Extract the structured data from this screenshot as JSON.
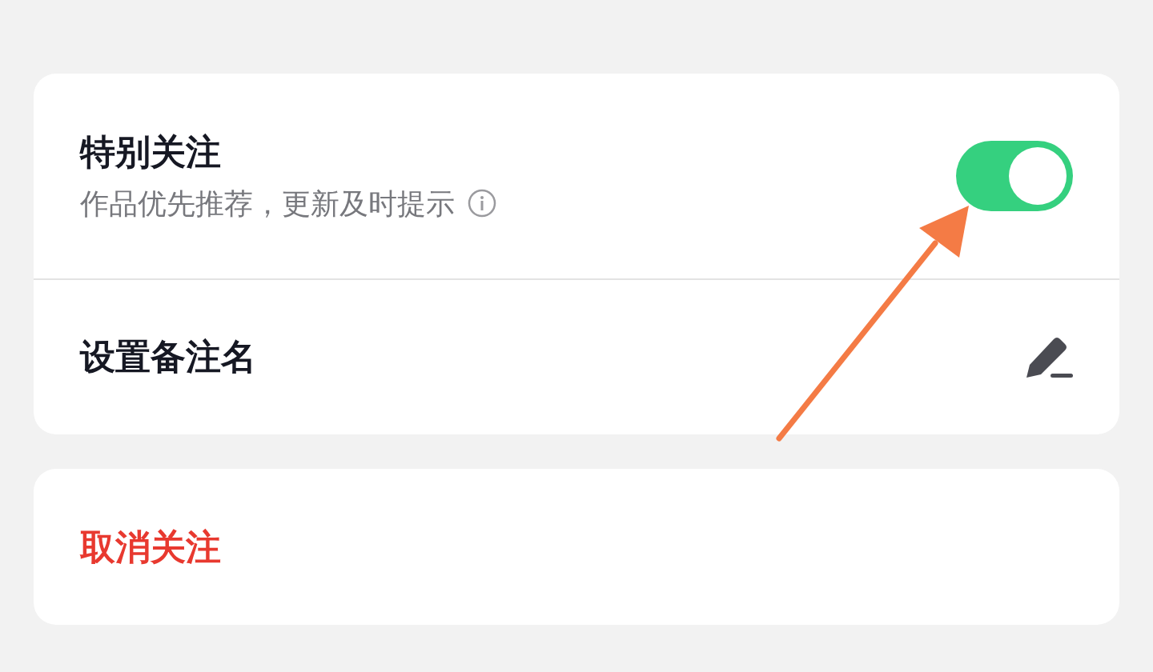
{
  "settings": [
    {
      "kind": "toggle",
      "title": "特别关注",
      "subtitle": "作品优先推荐，更新及时提示",
      "on": true
    },
    {
      "kind": "edit",
      "title": "设置备注名"
    }
  ],
  "actions": [
    {
      "label": "取消关注"
    }
  ]
}
